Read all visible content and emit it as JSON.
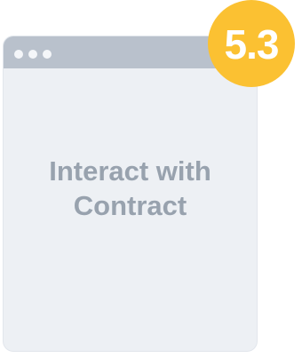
{
  "window": {
    "label_line1": "Interact with",
    "label_line2": "Contract"
  },
  "badge": {
    "value": "5.3"
  },
  "colors": {
    "window_body": "#edf0f4",
    "titlebar": "#b9c1cc",
    "label_text": "#98a2ae",
    "badge_fill": "#fbc132",
    "badge_text": "#ffffff"
  }
}
